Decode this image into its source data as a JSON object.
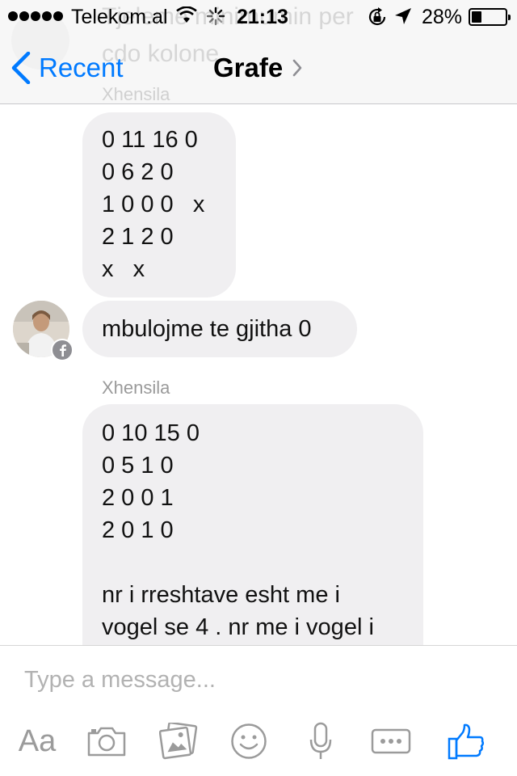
{
  "status_bar": {
    "carrier": "Telekom.al",
    "time": "21:13",
    "battery_percent": "28%",
    "battery_level": 0.28,
    "icons": [
      "signal-dots-icon",
      "wifi-icon",
      "activity-spinner-icon",
      "rotation-lock-icon",
      "location-arrow-icon",
      "battery-icon"
    ]
  },
  "nav": {
    "back_label": "Recent",
    "title": "Grafe",
    "accent_color": "#007aff"
  },
  "background_ghost": {
    "text": "Tjeleme minimumin per\ncdo kolone",
    "sender": "Xhensila"
  },
  "messages": [
    {
      "lines": [
        "0 11 16 0",
        "0 6 2 0",
        "1 0 0 0   x",
        "2 1 2 0",
        "x   x"
      ]
    },
    {
      "text": "mbulojme te gjitha 0"
    },
    {
      "sender": "Xhensila",
      "lines": [
        "0 10 15 0",
        "0 5 1 0",
        "2 0 0 1",
        "2 0 1 0",
        "",
        "nr i rreshtave esht me i",
        "vogel se 4 . nr me i vogel i"
      ]
    }
  ],
  "composer": {
    "placeholder": "Type a message...",
    "value": "",
    "aa_label": "Aa",
    "like_color": "#007aff"
  }
}
